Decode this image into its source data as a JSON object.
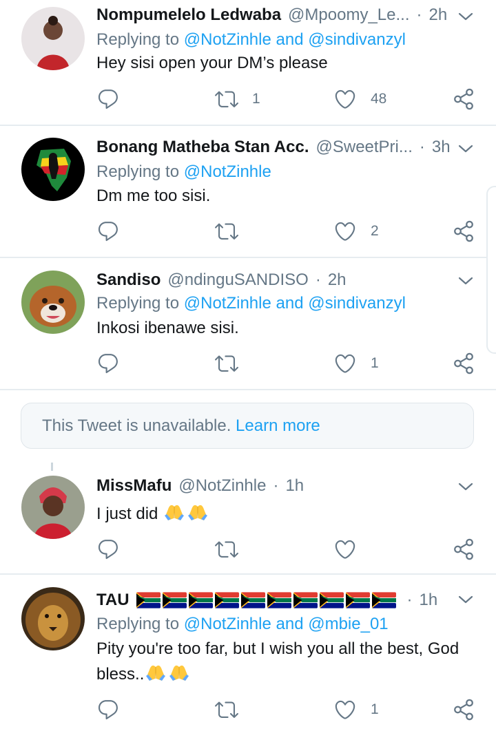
{
  "tweets": [
    {
      "name": "Nompumelelo Ledwaba",
      "handle": "@Mpoomy_Le...",
      "time": "2h",
      "replying_prefix": "Replying to",
      "mentions": "@NotZinhle and @sindivanzyl",
      "text": "Hey sisi open your DM’s please",
      "retweets": "1",
      "likes": "48"
    },
    {
      "name": "Bonang Matheba Stan Acc.",
      "handle": "@SweetPri...",
      "time": "3h",
      "replying_prefix": "Replying to",
      "mentions": "@NotZinhle",
      "text": "Dm me too sisi.",
      "retweets": "",
      "likes": "2"
    },
    {
      "name": "Sandiso",
      "handle": "@ndinguSANDISO",
      "time": "2h",
      "replying_prefix": "Replying to",
      "mentions": "@NotZinhle and @sindivanzyl",
      "text": "Inkosi ibenawe sisi.",
      "retweets": "",
      "likes": "1"
    },
    {
      "name": "MissMafu",
      "handle": "@NotZinhle",
      "time": "1h",
      "text": "I just did",
      "retweets": "",
      "likes": ""
    },
    {
      "name": "TAU",
      "handle": "",
      "time": "1h",
      "replying_prefix": "Replying to",
      "mentions": "@NotZinhle and @mbie_01",
      "text_line1": "Pity you're too far, but I wish you all the best, God",
      "text_line2": "bless..",
      "retweets": "",
      "likes": "1"
    }
  ],
  "unavailable": {
    "text": "This Tweet is unavailable.",
    "link": "Learn more"
  },
  "icons": {
    "reply": "reply-icon",
    "retweet": "retweet-icon",
    "like": "heart-icon",
    "share": "share-icon",
    "menu": "chevron-down-icon",
    "emoji": "folded-hands-emoji",
    "flag": "south-africa-flag-emoji"
  },
  "colors": {
    "link": "#1da1f2",
    "muted": "#657786",
    "divider": "#e6ecf0"
  }
}
